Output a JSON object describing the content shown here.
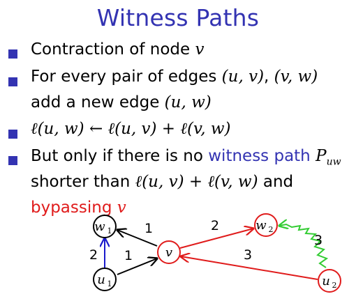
{
  "title": "Witness Paths",
  "colors": {
    "accent": "#3333b2",
    "red": "#e01b1b",
    "green": "#33cc33",
    "blue_edge": "#1a1acc"
  },
  "bullets": {
    "b1": {
      "text": "Contraction of node ",
      "var": "v"
    },
    "b2": {
      "text1": "For every pair of edges ",
      "pair1": "(u, v)",
      "comma": ", ",
      "pair2": "(v, w)",
      "text2": "add a new edge ",
      "pair3": "(u, w)"
    },
    "b3": {
      "formula": "ℓ(u, w) ← ℓ(u, v) + ℓ(v, w)"
    },
    "b4": {
      "text1": "But only if there is no ",
      "witness": "witness path",
      "p": "P",
      "psub": "uw",
      "text2": "shorter than ",
      "formula": "ℓ(u, v) + ℓ(v, w)",
      "and": " and",
      "bypassing": "bypassing",
      "v": "v"
    }
  },
  "diagram": {
    "nodes": {
      "w1": {
        "label": "w",
        "sub": "1"
      },
      "u1": {
        "label": "u",
        "sub": "1"
      },
      "v": {
        "label": "v"
      },
      "w2": {
        "label": "w",
        "sub": "2"
      },
      "u2": {
        "label": "u",
        "sub": "2"
      }
    },
    "edge_labels": {
      "v_w1": "1",
      "u1_w1": "2",
      "u1_v": "1",
      "v_w2": "2",
      "u2_v": "3",
      "u2_w2": "3"
    }
  }
}
